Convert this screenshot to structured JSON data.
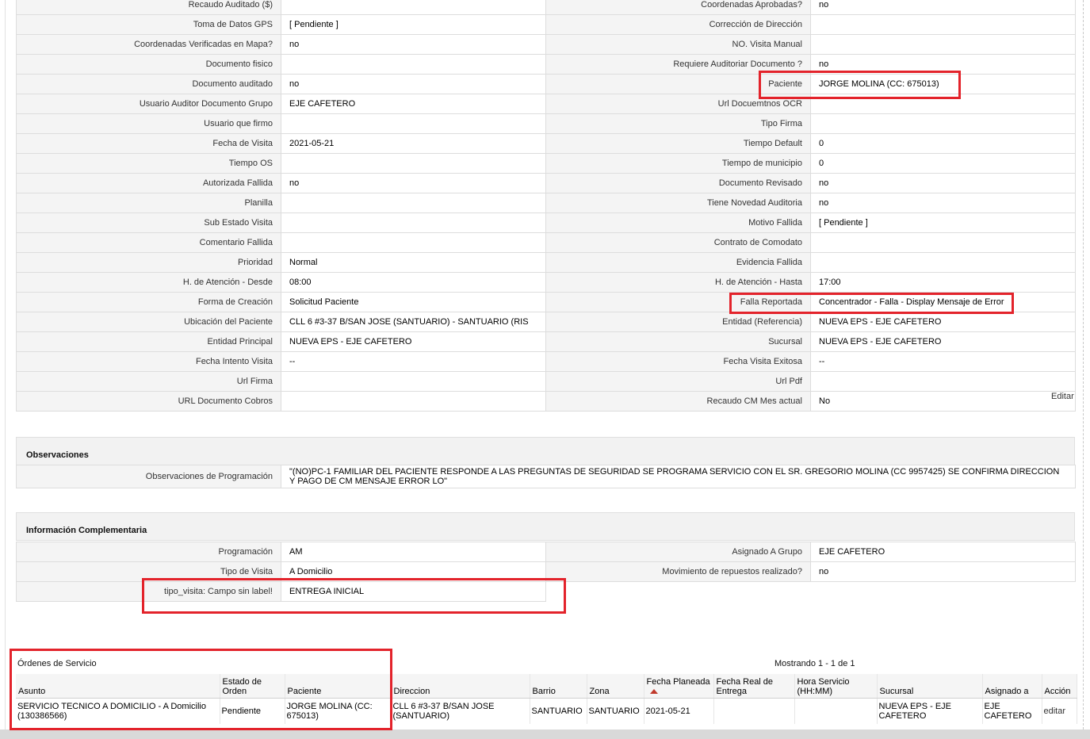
{
  "detail_rows": [
    {
      "l1": "Recaudo Auditado ($)",
      "v1": "",
      "l2": "Coordenadas Aprobadas?",
      "v2": " no"
    },
    {
      "l1": "Toma de Datos GPS",
      "v1": "[ Pendiente ]",
      "l2": "Corrección de Dirección",
      "v2": ""
    },
    {
      "l1": "Coordenadas Verificadas en Mapa?",
      "v1": " no",
      "l2": "NO. Visita Manual",
      "v2": ""
    },
    {
      "l1": "Documento fisico",
      "v1": "",
      "l2": "Requiere Auditoriar Documento ?",
      "v2": " no"
    },
    {
      "l1": "Documento auditado",
      "v1": " no",
      "l2": "Paciente",
      "v2": "JORGE MOLINA (CC: 675013)"
    },
    {
      "l1": "Usuario Auditor Documento Grupo",
      "v1": "EJE CAFETERO",
      "l2": "Url Docuemtnos OCR",
      "v2": ""
    },
    {
      "l1": "Usuario que firmo",
      "v1": "",
      "l2": "Tipo Firma",
      "v2": ""
    },
    {
      "l1": "Fecha de Visita",
      "v1": " 2021-05-21",
      "l2": "Tiempo Default",
      "v2": "0"
    },
    {
      "l1": "Tiempo OS",
      "v1": "",
      "l2": "Tiempo de municipio",
      "v2": "0"
    },
    {
      "l1": "Autorizada Fallida",
      "v1": " no",
      "l2": "Documento Revisado",
      "v2": " no"
    },
    {
      "l1": "Planilla",
      "v1": "",
      "l2": "Tiene Novedad Auditoria",
      "v2": " no"
    },
    {
      "l1": "Sub Estado Visita",
      "v1": "",
      "l2": "Motivo Fallida",
      "v2": "[ Pendiente ]"
    },
    {
      "l1": "Comentario Fallida",
      "v1": "",
      "l2": "Contrato de Comodato",
      "v2": ""
    },
    {
      "l1": "Prioridad",
      "v1": "Normal",
      "l2": "Evidencia Fallida",
      "v2": ""
    },
    {
      "l1": "H. de Atención - Desde",
      "v1": "08:00",
      "l2": "H. de Atención - Hasta",
      "v2": "17:00"
    },
    {
      "l1": "Forma de Creación",
      "v1": "Solicitud Paciente",
      "l2": "Falla Reportada",
      "v2": "Concentrador - Falla - Display Mensaje de Error"
    },
    {
      "l1": "Ubicación del Paciente",
      "v1": "CLL 6 #3-37 B/SAN JOSE (SANTUARIO) - SANTUARIO (RIS",
      "l2": "Entidad (Referencia)",
      "v2": "NUEVA EPS - EJE CAFETERO"
    },
    {
      "l1": "Entidad Principal",
      "v1": "NUEVA EPS - EJE CAFETERO",
      "l2": "Sucursal",
      "v2": "NUEVA EPS - EJE CAFETERO"
    },
    {
      "l1": "Fecha Intento Visita",
      "v1": " --",
      "l2": "Fecha Visita Exitosa",
      "v2": " --"
    },
    {
      "l1": "Url Firma",
      "v1": "",
      "l2": "Url Pdf",
      "v2": ""
    },
    {
      "l1": "URL Documento Cobros",
      "v1": "",
      "l2": "Recaudo CM Mes actual",
      "v2": " No"
    }
  ],
  "editar_label": "Editar",
  "observaciones": {
    "title": "Observaciones",
    "label": "Observaciones de Programación",
    "value": "\"(NO)PC-1 FAMILIAR DEL PACIENTE RESPONDE A LAS PREGUNTAS DE SEGURIDAD SE PROGRAMA SERVICIO CON EL SR. GREGORIO MOLINA (CC 9957425) SE CONFIRMA DIRECCION Y PAGO DE CM MENSAJE ERROR LO\""
  },
  "info": {
    "title": "Información Complementaria",
    "rows": [
      {
        "l1": "Programación",
        "v1": "AM",
        "l2": "Asignado A Grupo",
        "v2": "EJE CAFETERO"
      },
      {
        "l1": "Tipo de Visita",
        "v1": "A Domicilio",
        "l2": "Movimiento de repuestos realizado?",
        "v2": " no"
      }
    ],
    "extra": {
      "label": "tipo_visita: Campo sin label!",
      "value": "ENTREGA INICIAL"
    }
  },
  "orders": {
    "title": "Órdenes de Servicio",
    "mostrando": "Mostrando 1 - 1 de 1",
    "headers": [
      "Asunto",
      "Estado de Orden",
      "Paciente",
      "Direccion",
      "Barrio",
      "Zona",
      "Fecha Planeada",
      "Fecha Real de Entrega",
      "Hora Servicio (HH:MM)",
      "Sucursal",
      "Asignado a",
      "Acción"
    ],
    "rows": [
      {
        "asunto": "SERVICIO TECNICO A DOMICILIO - A Domicilio (130386566)",
        "estado": "Pendiente",
        "paciente": "JORGE MOLINA (CC: 675013)",
        "direccion": "CLL 6 #3-37 B/SAN JOSE (SANTUARIO)",
        "barrio": "SANTUARIO",
        "zona": "SANTUARIO",
        "fecha_planeada": "2021-05-21",
        "fecha_real": "",
        "hora": "",
        "sucursal": "NUEVA EPS - EJE CAFETERO",
        "asignado": "EJE CAFETERO",
        "accion": "editar"
      }
    ]
  },
  "colors": {
    "highlight": "#e3232b",
    "label_bg": "#f4f4f4",
    "sort_arrow": "#c0392b"
  }
}
